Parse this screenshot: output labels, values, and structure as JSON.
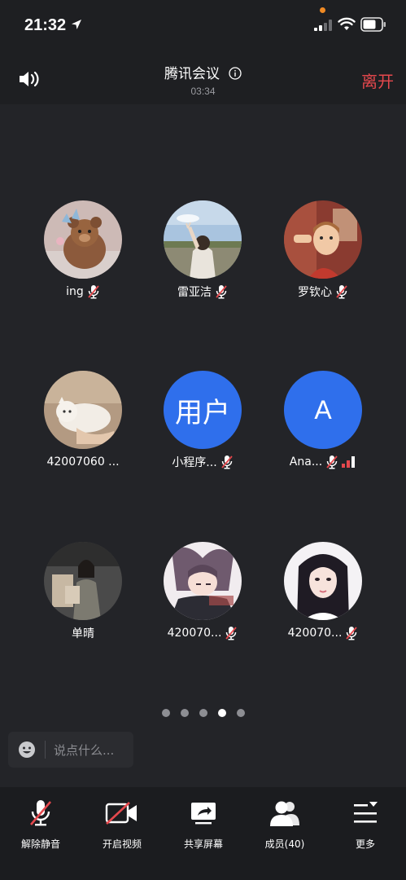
{
  "status_bar": {
    "time": "21:32"
  },
  "header": {
    "title": "腾讯会议",
    "duration": "03:34",
    "leave_label": "离开"
  },
  "participants": [
    {
      "name": "ing",
      "muted": true
    },
    {
      "name": "雷亚洁",
      "muted": true
    },
    {
      "name": "罗钦心",
      "muted": true
    },
    {
      "name": "42007060 ...",
      "muted": false
    },
    {
      "name": "小程序...",
      "muted": true,
      "avatar_text": "用户"
    },
    {
      "name": "Ana...",
      "muted": true,
      "avatar_text": "A"
    },
    {
      "name": "单晴",
      "muted": false
    },
    {
      "name": "420070...",
      "muted": true
    },
    {
      "name": "420070...",
      "muted": true
    }
  ],
  "pager": {
    "total": 5,
    "active_index": 3
  },
  "chat": {
    "placeholder": "说点什么..."
  },
  "toolbar": {
    "unmute_label": "解除静音",
    "video_label": "开启视频",
    "share_label": "共享屏幕",
    "members_label": "成员(40)",
    "more_label": "更多"
  },
  "colors": {
    "background": "#232428",
    "accent_blue": "#2f6fec",
    "leave_red": "#e5484d",
    "mute_red": "#e5484d"
  }
}
